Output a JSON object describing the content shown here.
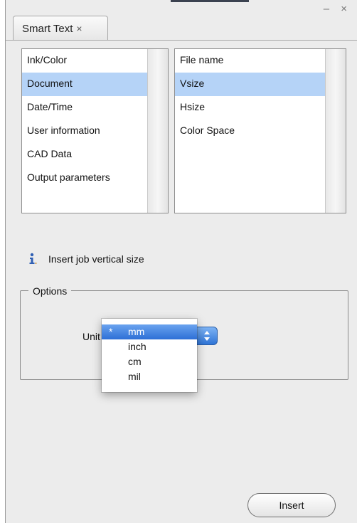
{
  "window": {
    "controls": "– ×"
  },
  "tab": {
    "label": "Smart Text",
    "close": "×"
  },
  "categories": {
    "items": [
      "Ink/Color",
      "Document",
      "Date/Time",
      "User information",
      "CAD Data",
      "Output parameters"
    ],
    "selected": "Document"
  },
  "fields": {
    "items": [
      "File name",
      "Vsize",
      "Hsize",
      "Color Space"
    ],
    "selected": "Vsize"
  },
  "hint": {
    "icon": "info-icon",
    "text": "Insert job vertical size"
  },
  "options": {
    "legend": "Options",
    "units_label": "Unit",
    "units_dropdown": {
      "selected": "mm",
      "selected_mark": "*",
      "options": [
        "mm",
        "inch",
        "cm",
        "mil"
      ]
    }
  },
  "actions": {
    "insert_label": "Insert"
  },
  "colors": {
    "selection": "#b5d3f7",
    "menu_highlight": "#2d6fd6",
    "panel_bg": "#ececec"
  }
}
